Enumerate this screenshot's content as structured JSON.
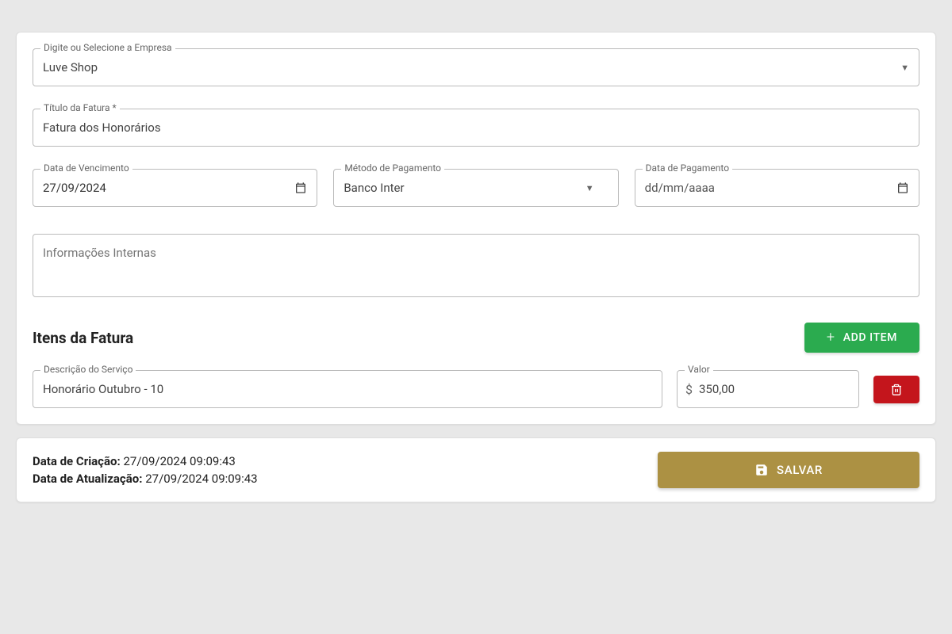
{
  "company_select": {
    "label": "Digite ou Selecione a Empresa",
    "value": "Luve Shop"
  },
  "title_field": {
    "label": "Título da Fatura *",
    "value": "Fatura dos Honorários"
  },
  "due_date": {
    "label": "Data de Vencimento",
    "value": "27/09/2024"
  },
  "payment_method": {
    "label": "Método de Pagamento",
    "value": "Banco Inter"
  },
  "payment_date": {
    "label": "Data de Pagamento",
    "placeholder": "dd/mm/aaaa"
  },
  "internal_info": {
    "placeholder": "Informações Internas"
  },
  "items_section": {
    "title": "Itens da Fatura",
    "add_button": "ADD ITEM"
  },
  "items": [
    {
      "desc_label": "Descrição do Serviço",
      "desc_value": "Honorário Outubro - 10",
      "valor_label": "Valor",
      "valor_value": "350,00"
    }
  ],
  "footer": {
    "created_label": "Data de Criação:",
    "created_value": "27/09/2024 09:09:43",
    "updated_label": "Data de Atualização:",
    "updated_value": "27/09/2024 09:09:43",
    "save_button": "SALVAR"
  }
}
